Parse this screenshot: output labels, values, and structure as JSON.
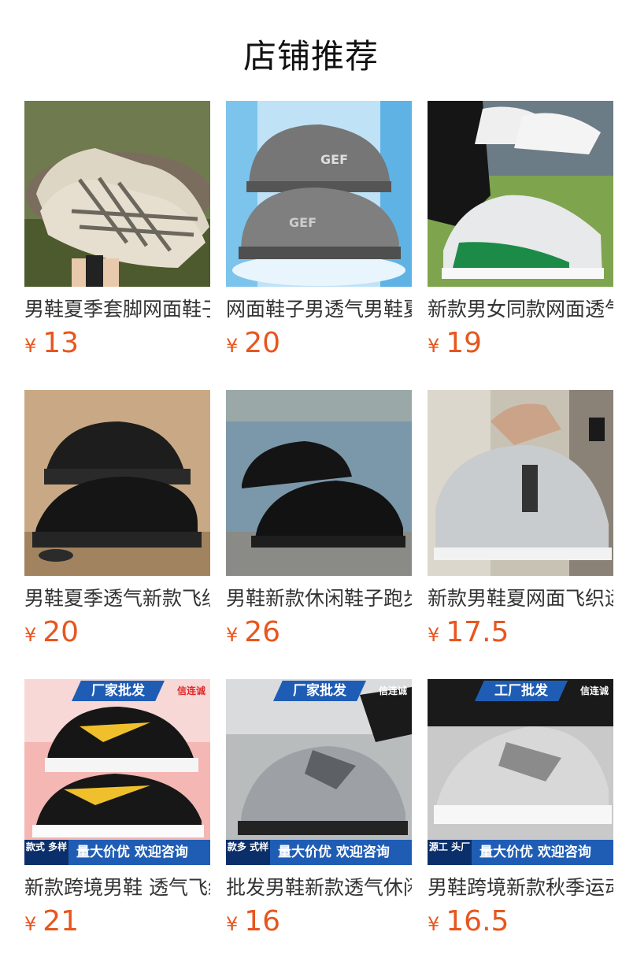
{
  "page": {
    "title": "店铺推荐"
  },
  "currency_symbol": "¥",
  "products": [
    {
      "name": "男鞋夏季套脚网面鞋子男款透气",
      "price": "13"
    },
    {
      "name": "网面鞋子男透气男鞋夏季新款",
      "price": "20"
    },
    {
      "name": "新款男女同款网面透气运动鞋",
      "price": "19"
    },
    {
      "name": "男鞋夏季透气新款飞织运动鞋",
      "price": "20"
    },
    {
      "name": "男鞋新款休闲鞋子跑步运动鞋",
      "price": "26"
    },
    {
      "name": "新款男鞋夏网面飞织运动鞋",
      "price": "17.5"
    },
    {
      "name": "新款跨境男鞋 透气飞织运动鞋",
      "price": "21",
      "badges": {
        "top": "厂家批发",
        "brand": "信连诚",
        "bottom_left": "款式 多样",
        "bottom_right": "量大价优 欢迎咨询"
      }
    },
    {
      "name": "批发男鞋新款透气休闲鞋",
      "price": "16",
      "badges": {
        "top": "厂家批发",
        "brand": "信连诚",
        "bottom_left": "款多 式样",
        "bottom_right": "量大价优 欢迎咨询"
      }
    },
    {
      "name": "男鞋跨境新款秋季运动鞋",
      "price": "16.5",
      "badges": {
        "top": "工厂批发",
        "brand": "信连诚",
        "bottom_left": "源工 头厂",
        "bottom_right": "量大价优 欢迎咨询"
      }
    }
  ]
}
